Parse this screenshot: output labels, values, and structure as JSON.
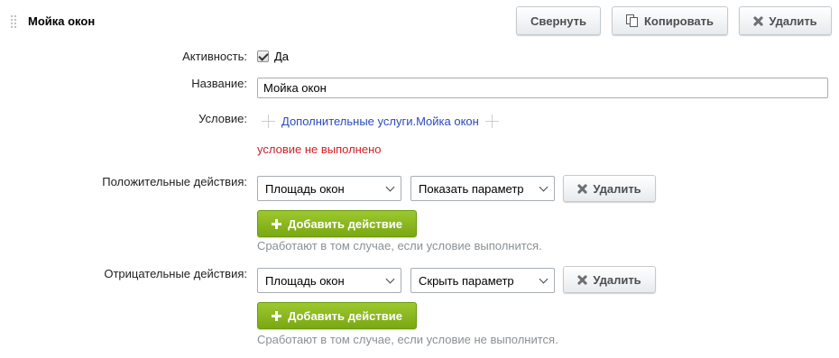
{
  "header": {
    "title": "Мойка окон",
    "collapse_label": "Свернуть",
    "copy_label": "Копировать",
    "delete_label": "Удалить"
  },
  "form": {
    "active": {
      "label": "Активность:",
      "checked": true,
      "value_label": "Да"
    },
    "name": {
      "label": "Название:",
      "value": "Мойка окон"
    },
    "condition": {
      "label": "Условие:",
      "link_text": "Дополнительные услуги.Мойка окон",
      "status_text": "условие не выполнено",
      "status_color": "#d21f26",
      "link_color": "#2a4bbd"
    },
    "positive": {
      "label": "Положительные действия:",
      "field_select": "Площадь окон",
      "action_select": "Показать параметр",
      "delete_label": "Удалить",
      "add_label": "Добавить действие",
      "hint": "Сработают в том случае, если условие выполнится."
    },
    "negative": {
      "label": "Отрицательные действия:",
      "field_select": "Площадь окон",
      "action_select": "Скрыть параметр",
      "delete_label": "Удалить",
      "add_label": "Добавить действие",
      "hint": "Сработают в том случае, если условие не выполнится."
    }
  },
  "colors": {
    "accent_green": "#8bb920"
  },
  "icons": [
    "drag-handle-icon",
    "copy-icon",
    "close-icon",
    "plus-icon"
  ]
}
